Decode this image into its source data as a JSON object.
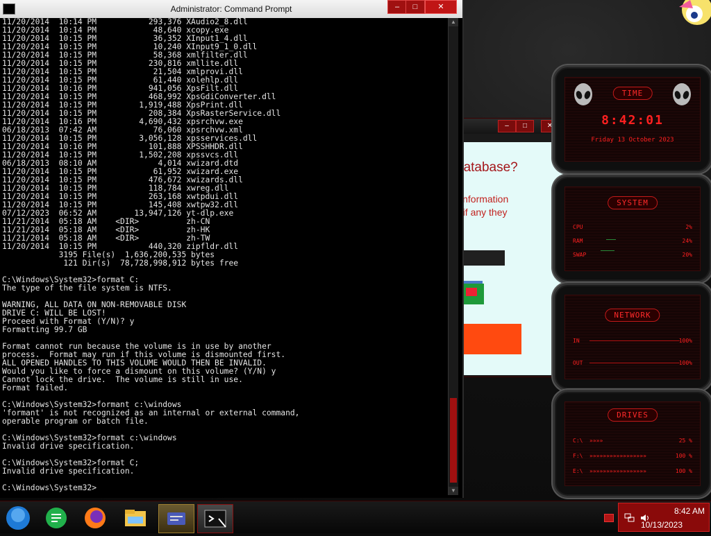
{
  "cmd": {
    "title": "Administrator: Command Prompt",
    "lines": [
      "11/20/2014  10:14 PM           293,376 XAudio2_8.dll",
      "11/20/2014  10:14 PM            48,640 xcopy.exe",
      "11/20/2014  10:15 PM            36,352 XInput1_4.dll",
      "11/20/2014  10:15 PM            10,240 XInput9_1_0.dll",
      "11/20/2014  10:15 PM            58,368 xmlfilter.dll",
      "11/20/2014  10:15 PM           230,816 xmllite.dll",
      "11/20/2014  10:15 PM            21,504 xmlprovi.dll",
      "11/20/2014  10:15 PM            61,440 xolehlp.dll",
      "11/20/2014  10:16 PM           941,056 XpsFilt.dll",
      "11/20/2014  10:15 PM           468,992 XpsGdiConverter.dll",
      "11/20/2014  10:15 PM         1,919,488 XpsPrint.dll",
      "11/20/2014  10:15 PM           208,384 XpsRasterService.dll",
      "11/20/2014  10:16 PM         4,690,432 xpsrchvw.exe",
      "06/18/2013  07:42 AM            76,060 xpsrchvw.xml",
      "11/20/2014  10:15 PM         3,056,128 xpsservices.dll",
      "11/20/2014  10:16 PM           101,888 XPSSHHDR.dll",
      "11/20/2014  10:15 PM         1,502,208 xpssvcs.dll",
      "06/18/2013  08:10 AM             4,014 xwizard.dtd",
      "11/20/2014  10:15 PM            61,952 xwizard.exe",
      "11/20/2014  10:15 PM           476,672 xwizards.dll",
      "11/20/2014  10:15 PM           118,784 xwreg.dll",
      "11/20/2014  10:15 PM           263,168 xwtpdui.dll",
      "11/20/2014  10:15 PM           145,408 xwtpw32.dll",
      "07/12/2023  06:52 AM        13,947,126 yt-dlp.exe",
      "11/21/2014  05:18 AM    <DIR>          zh-CN",
      "11/21/2014  05:18 AM    <DIR>          zh-HK",
      "11/21/2014  05:18 AM    <DIR>          zh-TW",
      "11/20/2014  10:15 PM           440,320 zipfldr.dll",
      "            3195 File(s)  1,636,200,535 bytes",
      "             121 Dir(s)  78,728,998,912 bytes free",
      "",
      "C:\\Windows\\System32>format C:",
      "The type of the file system is NTFS.",
      "",
      "WARNING, ALL DATA ON NON-REMOVABLE DISK",
      "DRIVE C: WILL BE LOST!",
      "Proceed with Format (Y/N)? y",
      "Formatting 99.7 GB",
      "",
      "Format cannot run because the volume is in use by another",
      "process.  Format may run if this volume is dismounted first.",
      "ALL OPENED HANDLES TO THIS VOLUME WOULD THEN BE INVALID.",
      "Would you like to force a dismount on this volume? (Y/N) y",
      "Cannot lock the drive.  The volume is still in use.",
      "Format failed.",
      "",
      "C:\\Windows\\System32>formant c:\\windows",
      "'formant' is not recognized as an internal or external command,",
      "operable program or batch file.",
      "",
      "C:\\Windows\\System32>format c:\\windows",
      "Invalid drive specification.",
      "",
      "C:\\Windows\\System32>format C;",
      "Invalid drive specification.",
      "",
      "C:\\Windows\\System32>"
    ]
  },
  "background_window": {
    "question": "database?",
    "info_line1": "information",
    "info_line2": "e if any they"
  },
  "gadgets": {
    "time": {
      "title": "TIME",
      "clock": "8:42:01",
      "date": "Friday 13 October 2023"
    },
    "system": {
      "title": "SYSTEM",
      "rows": [
        {
          "label": "CPU",
          "value": "2%"
        },
        {
          "label": "RAM",
          "value": "24%"
        },
        {
          "label": "SWAP",
          "value": "20%"
        }
      ]
    },
    "network": {
      "title": "NETWORK",
      "rows": [
        {
          "label": "IN",
          "value": "100%"
        },
        {
          "label": "OUT",
          "value": "100%"
        }
      ]
    },
    "drives": {
      "title": "DRIVES",
      "rows": [
        {
          "label": "C:\\",
          "value": "25 %"
        },
        {
          "label": "F:\\",
          "value": "100 %"
        },
        {
          "label": "E:\\",
          "value": "100 %"
        }
      ]
    }
  },
  "taskbar": {
    "items": [
      "start-orb",
      "notes-app",
      "firefox",
      "file-explorer",
      "card-app",
      "command-prompt"
    ],
    "clock_time": "8:42 AM",
    "clock_date": "10/13/2023"
  },
  "colors": {
    "accent_red": "#ff2020",
    "taskbar_tray": "#8a0a0a",
    "console_bg": "#000000",
    "console_text": "#e6e6e6"
  }
}
